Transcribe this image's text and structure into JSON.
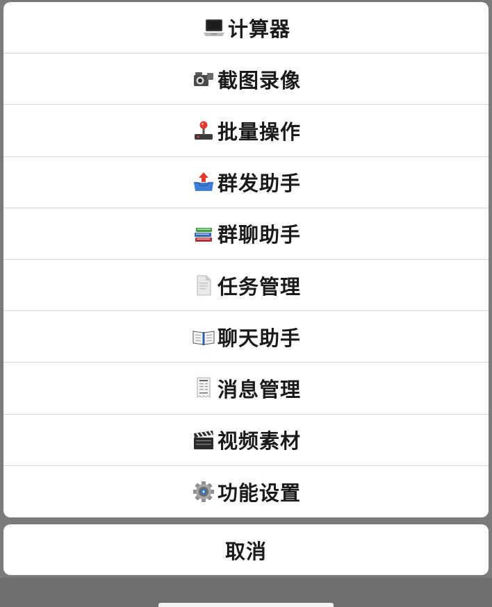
{
  "menu": {
    "items": [
      {
        "label": "计算器",
        "icon": "laptop-icon"
      },
      {
        "label": "截图录像",
        "icon": "video-camera-icon"
      },
      {
        "label": "批量操作",
        "icon": "joystick-icon"
      },
      {
        "label": "群发助手",
        "icon": "outbox-tray-icon"
      },
      {
        "label": "群聊助手",
        "icon": "books-stack-icon"
      },
      {
        "label": "任务管理",
        "icon": "document-icon"
      },
      {
        "label": "聊天助手",
        "icon": "open-book-icon"
      },
      {
        "label": "消息管理",
        "icon": "receipt-icon"
      },
      {
        "label": "视频素材",
        "icon": "clapper-board-icon"
      },
      {
        "label": "功能设置",
        "icon": "gear-icon"
      }
    ]
  },
  "cancel": {
    "label": "取消"
  }
}
